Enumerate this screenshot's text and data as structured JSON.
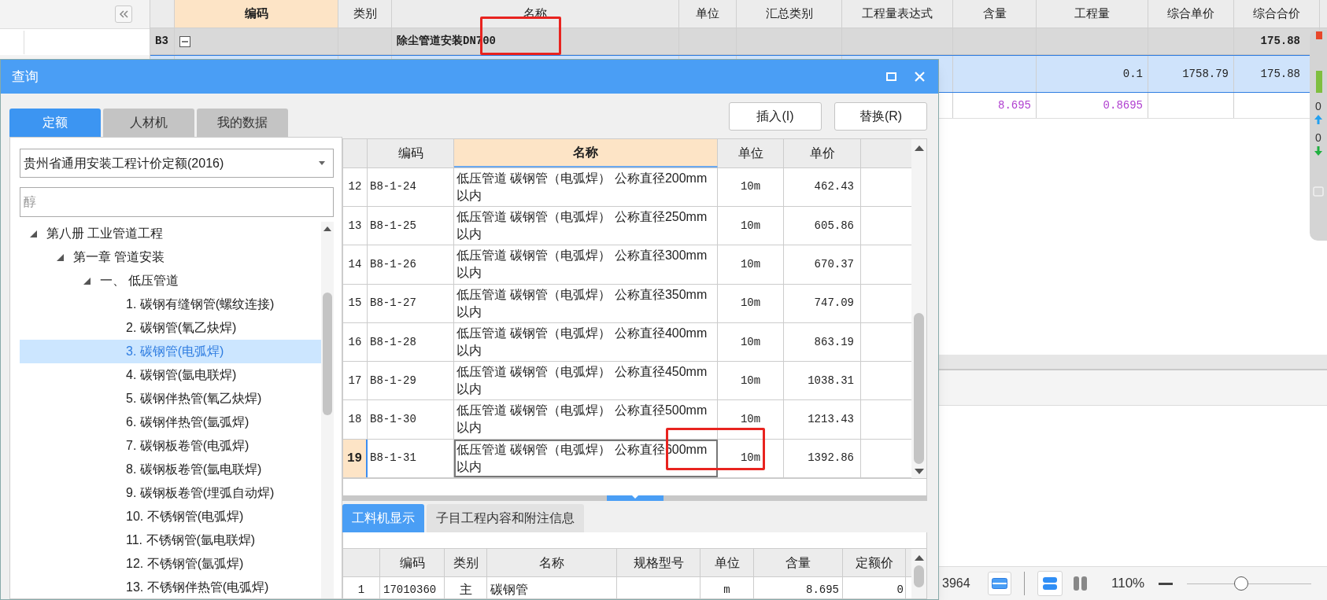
{
  "app_grid": {
    "columns": [
      {
        "label": "编码",
        "active": true
      },
      {
        "label": "类别",
        "active": false
      },
      {
        "label": "名称",
        "active": false
      },
      {
        "label": "单位",
        "active": false
      },
      {
        "label": "汇总类别",
        "active": false
      },
      {
        "label": "工程量表达式",
        "active": false
      },
      {
        "label": "含量",
        "active": false
      },
      {
        "label": "工程量",
        "active": false
      },
      {
        "label": "综合单价",
        "active": false
      },
      {
        "label": "综合合价",
        "active": false
      }
    ],
    "rows": [
      {
        "kind": "group",
        "selected": false,
        "label": "B3",
        "expanded": true,
        "name": "除尘管道安装DN700",
        "total": "175.88"
      },
      {
        "kind": "item",
        "selected": true,
        "quantity": "0.1",
        "unit_price": "1758.79",
        "total": "175.88"
      },
      {
        "kind": "sub",
        "selected": false,
        "content": "8.695",
        "quantity": "0.8695"
      }
    ]
  },
  "query_dialog": {
    "title": "查询",
    "tabs": [
      {
        "label": "定额",
        "selected": true
      },
      {
        "label": "人材机",
        "selected": false
      },
      {
        "label": "我的数据",
        "selected": false
      }
    ],
    "buttons": [
      "插入(I)",
      "替换(R)"
    ],
    "library_select": {
      "value": "贵州省通用安装工程计价定额(2016)"
    },
    "search": {
      "placeholder": "醇"
    },
    "tree": [
      {
        "label": "第八册 工业管道工程",
        "expanded": true,
        "selected": false,
        "children": [
          {
            "label": "第一章 管道安装",
            "expanded": true,
            "selected": false,
            "children": [
              {
                "label": "一、 低压管道",
                "expanded": true,
                "selected": false,
                "children": [
                  {
                    "label": "1. 碳钢有缝钢管(螺纹连接)",
                    "selected": false
                  },
                  {
                    "label": "2. 碳钢管(氧乙炔焊)",
                    "selected": false
                  },
                  {
                    "label": "3. 碳钢管(电弧焊)",
                    "selected": true
                  },
                  {
                    "label": "4. 碳钢管(氩电联焊)",
                    "selected": false
                  },
                  {
                    "label": "5. 碳钢伴热管(氧乙炔焊)",
                    "selected": false
                  },
                  {
                    "label": "6. 碳钢伴热管(氩弧焊)",
                    "selected": false
                  },
                  {
                    "label": "7. 碳钢板卷管(电弧焊)",
                    "selected": false
                  },
                  {
                    "label": "8. 碳钢板卷管(氩电联焊)",
                    "selected": false
                  },
                  {
                    "label": "9. 碳钢板卷管(埋弧自动焊)",
                    "selected": false
                  },
                  {
                    "label": "10. 不锈钢管(电弧焊)",
                    "selected": false
                  },
                  {
                    "label": "11. 不锈钢管(氩电联焊)",
                    "selected": false
                  },
                  {
                    "label": "12. 不锈钢管(氩弧焊)",
                    "selected": false
                  },
                  {
                    "label": "13. 不锈钢伴热管(电弧焊)",
                    "selected": false
                  }
                ]
              }
            ]
          }
        ]
      }
    ],
    "quota_table": {
      "columns": [
        {
          "label": "编码",
          "active": false
        },
        {
          "label": "名称",
          "active": true
        },
        {
          "label": "单位",
          "active": false
        },
        {
          "label": "单价",
          "active": false
        }
      ],
      "rows": [
        {
          "number": "12",
          "code": "B8-1-24",
          "name": "低压管道 碳钢管（电弧焊） 公称直径200mm以内",
          "unit": "10m",
          "price": "462.43",
          "selected": false
        },
        {
          "number": "13",
          "code": "B8-1-25",
          "name": "低压管道 碳钢管（电弧焊） 公称直径250mm以内",
          "unit": "10m",
          "price": "605.86",
          "selected": false
        },
        {
          "number": "14",
          "code": "B8-1-26",
          "name": "低压管道 碳钢管（电弧焊） 公称直径300mm以内",
          "unit": "10m",
          "price": "670.37",
          "selected": false
        },
        {
          "number": "15",
          "code": "B8-1-27",
          "name": "低压管道 碳钢管（电弧焊） 公称直径350mm以内",
          "unit": "10m",
          "price": "747.09",
          "selected": false
        },
        {
          "number": "16",
          "code": "B8-1-28",
          "name": "低压管道 碳钢管（电弧焊） 公称直径400mm以内",
          "unit": "10m",
          "price": "863.19",
          "selected": false
        },
        {
          "number": "17",
          "code": "B8-1-29",
          "name": "低压管道 碳钢管（电弧焊） 公称直径450mm以内",
          "unit": "10m",
          "price": "1038.31",
          "selected": false
        },
        {
          "number": "18",
          "code": "B8-1-30",
          "name": "低压管道 碳钢管（电弧焊） 公称直径500mm以内",
          "unit": "10m",
          "price": "1213.43",
          "selected": false
        },
        {
          "number": "19",
          "code": "B8-1-31",
          "name": "低压管道 碳钢管（电弧焊） 公称直径600mm以内",
          "unit": "10m",
          "price": "1392.86",
          "selected": true
        }
      ]
    },
    "detail_tabs": [
      {
        "label": "工料机显示",
        "selected": true
      },
      {
        "label": "子目工程内容和附注信息",
        "selected": false
      }
    ],
    "resource_table": {
      "columns": [
        "编码",
        "类别",
        "名称",
        "规格型号",
        "单位",
        "含量",
        "定额价"
      ],
      "rows": [
        {
          "number": "1",
          "code": "17010360",
          "category": "主",
          "name": "碳钢管",
          "unit": "m",
          "content": "8.695",
          "price": "0"
        }
      ]
    }
  },
  "status_bar": {
    "count": "3964",
    "zoom": "110%",
    "zoom_slider": {
      "level": 0.43
    }
  },
  "side_panel": {
    "counts": [
      "0",
      "0"
    ]
  },
  "highlight_marks": [
    {
      "kind": "rectangle"
    },
    {
      "kind": "rectangle"
    }
  ]
}
